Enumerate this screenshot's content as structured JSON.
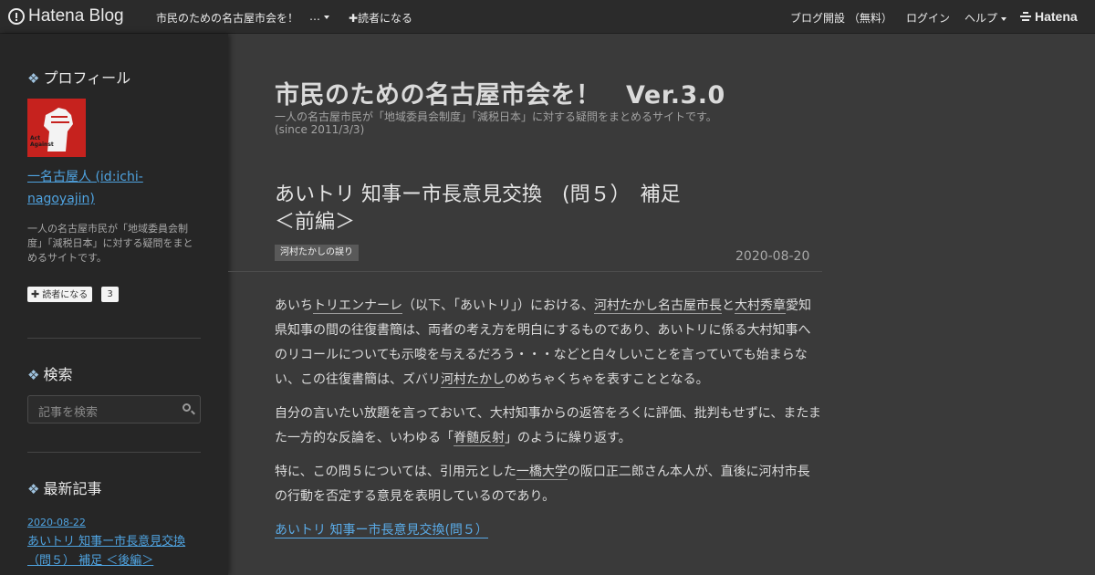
{
  "topbar": {
    "logo_text": "Hatena Blog",
    "blog_name": "市民のための名古屋市会を！",
    "more_label": "…",
    "subscribe_label": "✚読者になる",
    "open_blog_label": "ブログ開設 （無料）",
    "login_label": "ログイン",
    "help_label": "ヘルプ",
    "hatena_label": "Hatena"
  },
  "sidebar": {
    "profile_heading": "プロフィール",
    "profile_link": "一名古屋人 (id:ichi-nagoyajin)",
    "profile_desc": "一人の名古屋市民が「地域委員会制度」「減税日本」に対する疑問をまとめるサイトです。",
    "read_button": "読者になる",
    "read_count": "3",
    "search_heading": "検索",
    "search_placeholder": "記事を検索",
    "recent_heading": "最新記事",
    "recent_date": "2020-08-22",
    "recent_title": "あいトリ 知事ー市長意見交換 （問５） 補足 ＜後編＞",
    "avatar_text": "Act Against"
  },
  "main": {
    "blog_title": "市民のための名古屋市会を！　Ver.3.0",
    "blog_desc_line1": "一人の名古屋市民が「地域委員会制度」「減税日本」に対する疑問をまとめるサイトです。",
    "blog_desc_line2": "(since 2011/3/3)",
    "entry_title": "あいトリ 知事ー市長意見交換　(問５）　補足　＜前編＞",
    "tag": "河村たかしの誤り",
    "entry_date": "2020-08-20",
    "p1": {
      "a": "あいち",
      "kw1": "トリエンナーレ",
      "b": "（以下、「あいトリ」）における、",
      "kw2": "河村たかし",
      "kw3": "名古屋市長",
      "c": "と",
      "kw4": "大村秀章",
      "d": "愛知県知事の間の往復書簡は、両者の考え方を明白にするものであり、あいトリに係る大村知事へのリコールについても示唆を与えるだろう・・・などと白々しいことを言っていても始まらない、この往復書簡は、ズバリ",
      "kw5": "河村たかし",
      "e": "のめちゃくちゃを表すこととなる。"
    },
    "p2": {
      "a": "自分の言いたい放題を言っておいて、大村知事からの返答をろくに評価、批判もせずに、またまた一方的な反論を、いわゆる「",
      "kw1": "脊髄反射",
      "b": "」のように繰り返す。"
    },
    "p3": {
      "a": "特に、この問５については、引用元とした",
      "kw1": "一橋大学",
      "b": "の阪口正二郎さん本人が、直後に河村市長の行動を否定する意見を表明しているのであり。"
    },
    "link_line": "あいトリ 知事ー市長意見交換(問５）"
  }
}
